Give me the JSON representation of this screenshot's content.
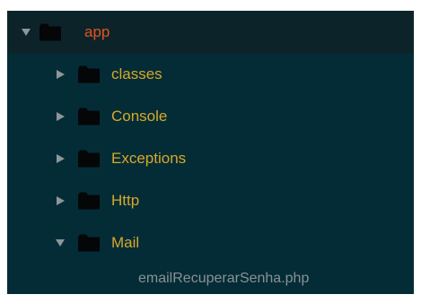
{
  "tree": {
    "root": {
      "label": "app",
      "expanded": true
    },
    "children": [
      {
        "label": "classes",
        "expanded": false
      },
      {
        "label": "Console",
        "expanded": false
      },
      {
        "label": "Exceptions",
        "expanded": false
      },
      {
        "label": "Http",
        "expanded": false
      },
      {
        "label": "Mail",
        "expanded": true
      }
    ],
    "file": {
      "label": "emailRecuperarSenha.php"
    }
  },
  "colors": {
    "panel_bg": "#032c36",
    "selected_row_bg": "#0c2329",
    "root_label": "#e2541f",
    "folder_label": "#d9a72a",
    "file_label": "#8a9195",
    "arrow": "#8e969a",
    "folder_icon": "#050607"
  },
  "icons": {
    "expanded_arrow": "triangle-down-icon",
    "collapsed_arrow": "triangle-right-icon",
    "folder": "folder-icon"
  }
}
